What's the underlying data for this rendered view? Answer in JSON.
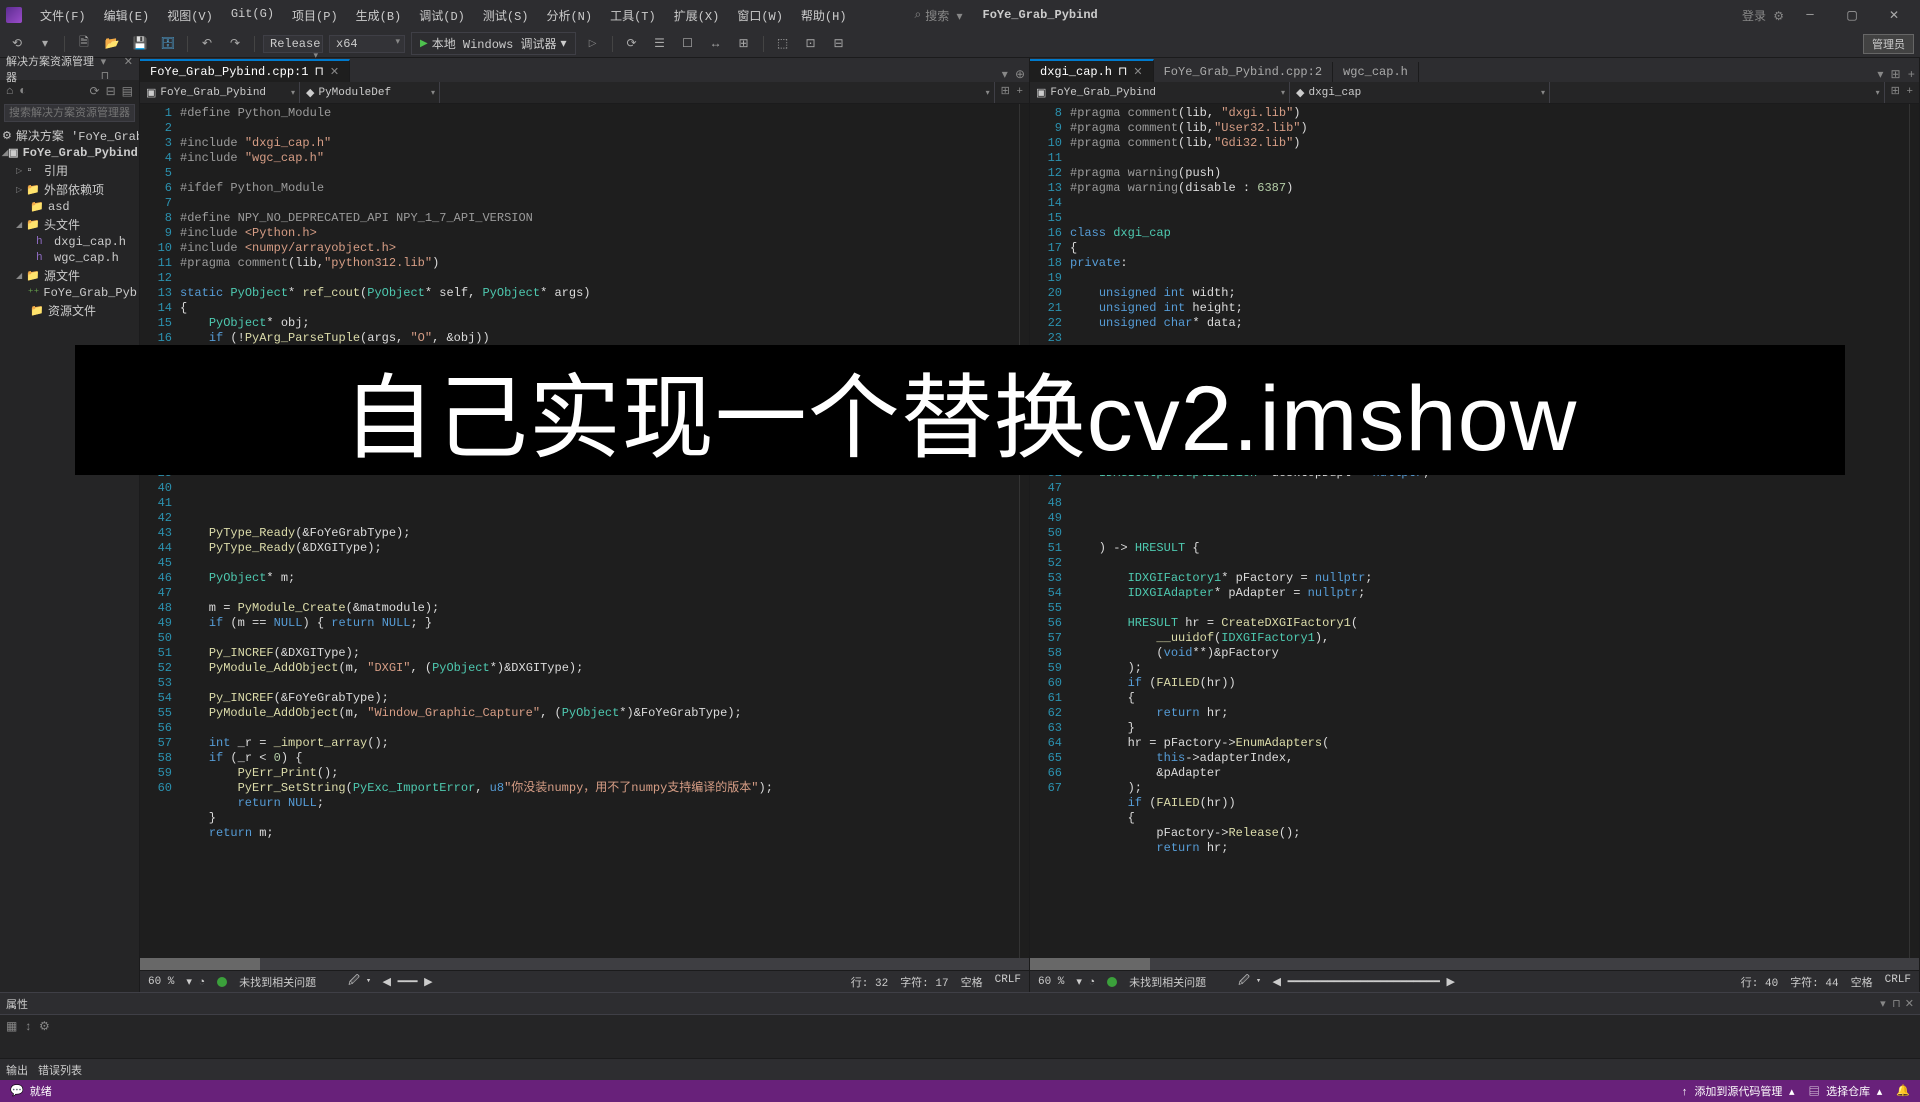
{
  "titlebar": {
    "menus": [
      "文件(F)",
      "编辑(E)",
      "视图(V)",
      "Git(G)",
      "项目(P)",
      "生成(B)",
      "调试(D)",
      "测试(S)",
      "分析(N)",
      "工具(T)",
      "扩展(X)",
      "窗口(W)",
      "帮助(H)"
    ],
    "search_placeholder": "搜索 ▾",
    "project": "FoYe_Grab_Pybind",
    "login": "登录",
    "admin": "管理员"
  },
  "toolbar": {
    "config": "Release",
    "platform": "x64",
    "debugger": "本地 Windows 调试器"
  },
  "solution": {
    "panel_title": "解决方案资源管理器",
    "search_placeholder": "搜索解决方案资源管理器",
    "root": "解决方案 'FoYe_Grab_Pyb",
    "project": "FoYe_Grab_Pybind",
    "refs": "引用",
    "external": "外部依赖项",
    "asd": "asd",
    "headers": "头文件",
    "h1": "dxgi_cap.h",
    "h2": "wgc_cap.h",
    "sources": "源文件",
    "src1": "FoYe_Grab_Pyb",
    "resources": "资源文件"
  },
  "left_editor": {
    "tab": "FoYe_Grab_Pybind.cpp:1",
    "nav1": "FoYe_Grab_Pybind",
    "nav2": "PyModuleDef",
    "line_start": 1,
    "status": {
      "zoom": "60 %",
      "issues": "未找到相关问题",
      "line": "行: 32",
      "char": "字符: 17",
      "space": "空格",
      "crlf": "CRLF"
    }
  },
  "right_editor": {
    "tabs": [
      "dxgi_cap.h",
      "FoYe_Grab_Pybind.cpp:2",
      "wgc_cap.h"
    ],
    "nav1": "FoYe_Grab_Pybind",
    "nav2": "dxgi_cap",
    "line_start": 8,
    "status": {
      "zoom": "60 %",
      "issues": "未找到相关问题",
      "line": "行: 40",
      "char": "字符: 44",
      "space": "空格",
      "crlf": "CRLF"
    }
  },
  "props_title": "属性",
  "output_tabs": [
    "输出",
    "错误列表"
  ],
  "statusbar": {
    "ready": "就绪",
    "src_ctrl": "添加到源代码管理 ▴",
    "repo": "选择仓库 ▴"
  },
  "overlay": "自己实现一个替换cv2.imshow"
}
